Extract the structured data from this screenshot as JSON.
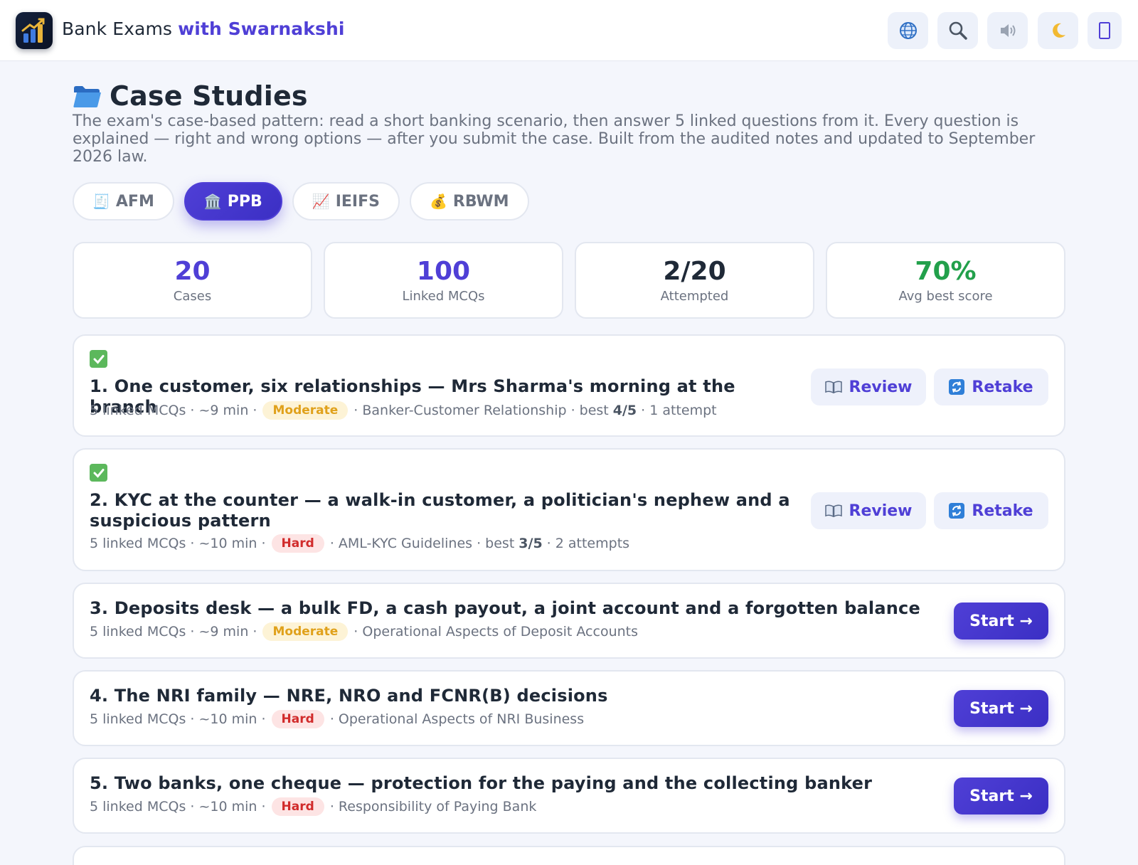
{
  "header": {
    "brand_plain": "Bank Exams",
    "brand_accent": "with Swarnakshi",
    "icons": [
      "globe-icon",
      "search-icon",
      "speaker-icon",
      "moon-icon",
      "menu-icon"
    ]
  },
  "page": {
    "title": "Case Studies",
    "description": "The exam's case-based pattern: read a short banking scenario, then answer 5 linked questions from it. Every question is explained — right and wrong options — after you submit the case. Built from the audited notes and updated to September 2026 law."
  },
  "tabs": [
    {
      "label": "AFM",
      "emoji": "🧾",
      "active": false
    },
    {
      "label": "PPB",
      "emoji": "🏛️",
      "active": true
    },
    {
      "label": "IEIFS",
      "emoji": "📈",
      "active": false
    },
    {
      "label": "RBWM",
      "emoji": "💰",
      "active": false
    }
  ],
  "stats": [
    {
      "value": "20",
      "label": "Cases",
      "color": "#4f3fd6"
    },
    {
      "value": "100",
      "label": "Linked MCQs",
      "color": "#4f3fd6"
    },
    {
      "value": "2/20",
      "label": "Attempted",
      "color": "#1f2937"
    },
    {
      "value": "70%",
      "label": "Avg best score",
      "color": "#22a04b"
    }
  ],
  "cases": [
    {
      "title": "1. One customer, six relationships — Mrs Sharma's morning at the branch",
      "mcqs": "5 linked MCQs",
      "time": "~9 min",
      "difficulty": "Moderate",
      "topic": "Banker-Customer Relationship",
      "best_prefix": "best",
      "best": "4/5",
      "attempts": "1 attempt",
      "completed": true,
      "review_label": "Review",
      "retake_label": "Retake"
    },
    {
      "title": "2. KYC at the counter — a walk-in customer, a politician's nephew and a suspicious pattern",
      "mcqs": "5 linked MCQs",
      "time": "~10 min",
      "difficulty": "Hard",
      "topic": "AML-KYC Guidelines",
      "best_prefix": "best",
      "best": "3/5",
      "attempts": "2 attempts",
      "completed": true,
      "review_label": "Review",
      "retake_label": "Retake"
    },
    {
      "title": "3. Deposits desk — a bulk FD, a cash payout, a joint account and a forgotten balance",
      "mcqs": "5 linked MCQs",
      "time": "~9 min",
      "difficulty": "Moderate",
      "topic": "Operational Aspects of Deposit Accounts",
      "completed": false,
      "start_label": "Start →"
    },
    {
      "title": "4. The NRI family — NRE, NRO and FCNR(B) decisions",
      "mcqs": "5 linked MCQs",
      "time": "~10 min",
      "difficulty": "Hard",
      "topic": "Operational Aspects of NRI Business",
      "completed": false,
      "start_label": "Start →"
    },
    {
      "title": "5. Two banks, one cheque — protection for the paying and the collecting banker",
      "mcqs": "5 linked MCQs",
      "time": "~10 min",
      "difficulty": "Hard",
      "topic": "Responsibility of Paying Bank",
      "completed": false,
      "start_label": "Start →"
    }
  ]
}
